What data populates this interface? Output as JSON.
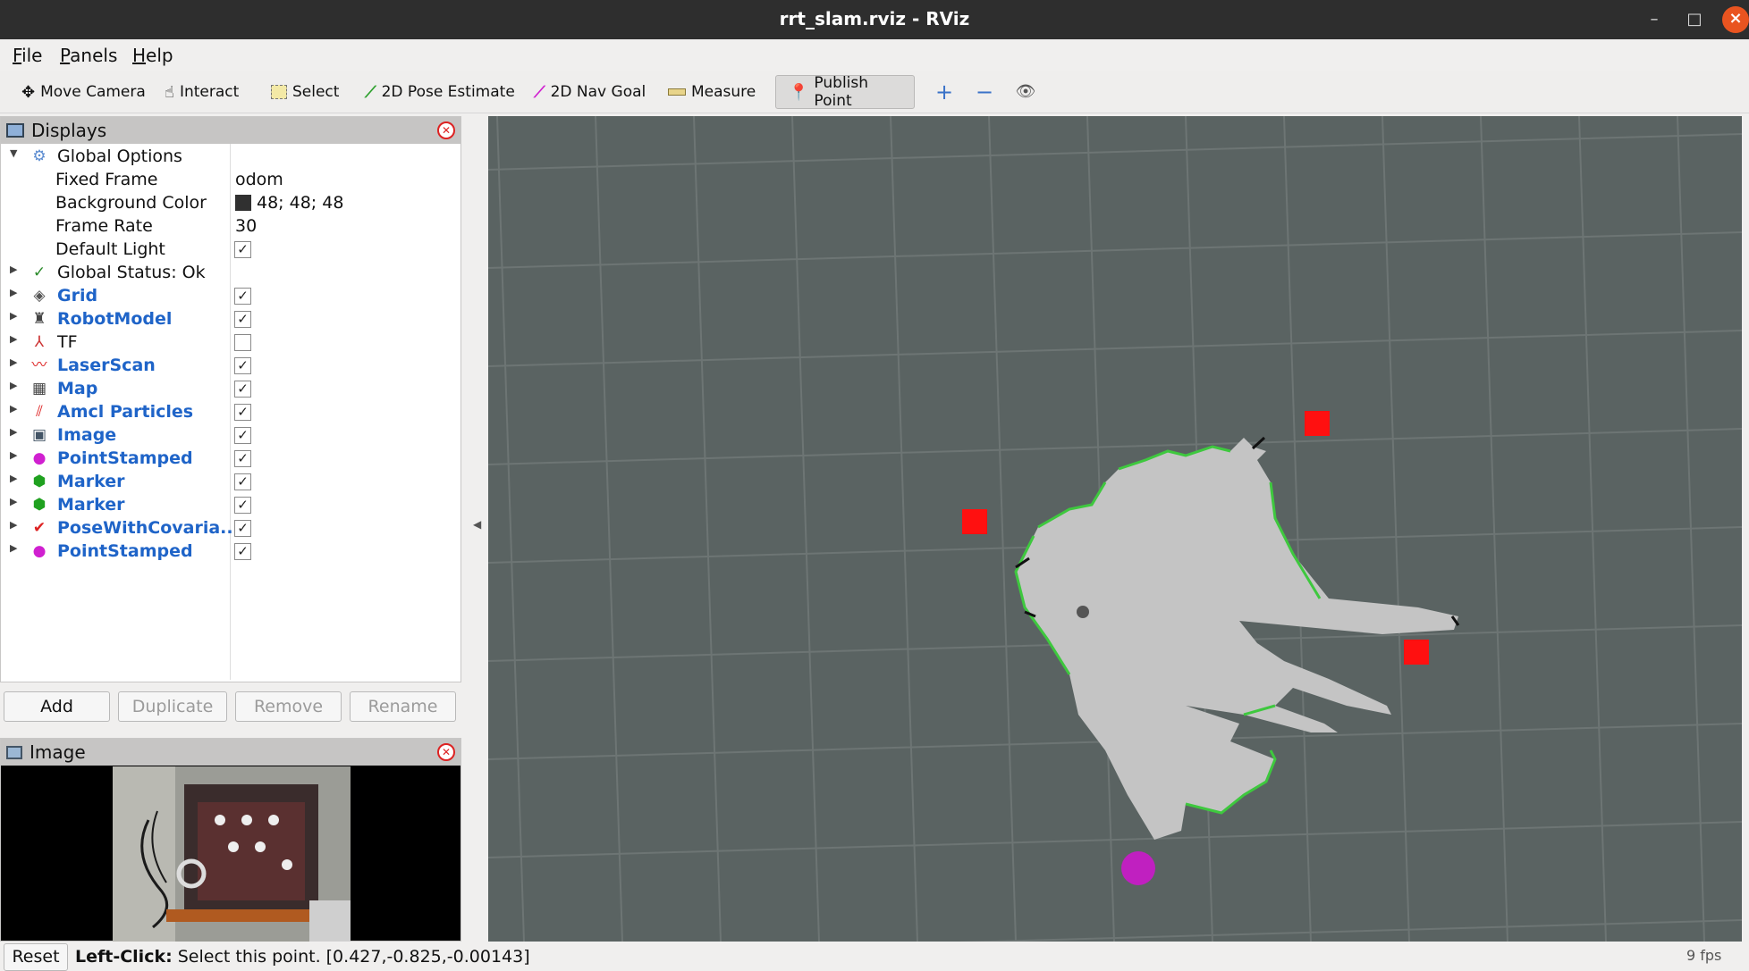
{
  "window": {
    "title": "rrt_slam.rviz - RViz",
    "minimize": "–",
    "maximize": "□",
    "close": "×"
  },
  "menu": [
    "File",
    "Panels",
    "Help"
  ],
  "toolbar": {
    "tools": [
      "Move Camera",
      "Interact",
      "Select",
      "2D Pose Estimate",
      "2D Nav Goal",
      "Measure",
      "Publish Point"
    ],
    "active_tool": "Publish Point",
    "zoom_in": "+",
    "zoom_out": "−",
    "view": "👁"
  },
  "displays": {
    "title": "Displays",
    "global_options": {
      "label": "Global Options",
      "fixed_frame_label": "Fixed Frame",
      "fixed_frame": "odom",
      "bg_color_label": "Background Color",
      "bg_color": "48; 48; 48",
      "bg_color_hex": "#303030",
      "frame_rate_label": "Frame Rate",
      "frame_rate": "30",
      "default_light_label": "Default Light"
    },
    "global_status": "Global Status: Ok",
    "items": [
      {
        "label": "Grid",
        "checked": "✓",
        "icon": "grid-icon"
      },
      {
        "label": "RobotModel",
        "checked": "✓",
        "icon": "robot-icon"
      },
      {
        "label": "TF",
        "checked": "",
        "icon": "tf-icon"
      },
      {
        "label": "LaserScan",
        "checked": "✓",
        "icon": "laserscan-icon"
      },
      {
        "label": "Map",
        "checked": "✓",
        "icon": "map-icon"
      },
      {
        "label": "Amcl Particles",
        "checked": "✓",
        "icon": "particles-icon"
      },
      {
        "label": "Image",
        "checked": "✓",
        "icon": "image-icon"
      },
      {
        "label": "PointStamped",
        "checked": "✓",
        "icon": "point-icon"
      },
      {
        "label": "Marker",
        "checked": "✓",
        "icon": "marker-icon"
      },
      {
        "label": "Marker",
        "checked": "✓",
        "icon": "marker-icon"
      },
      {
        "label": "PoseWithCovaria...",
        "checked": "✓",
        "icon": "pose-icon"
      },
      {
        "label": "PointStamped",
        "checked": "✓",
        "icon": "point-icon"
      }
    ],
    "buttons": {
      "add": "Add",
      "duplicate": "Duplicate",
      "remove": "Remove",
      "rename": "Rename"
    }
  },
  "image_panel": {
    "title": "Image"
  },
  "status_bar": {
    "reset": "Reset",
    "hint_bold": "Left-Click:",
    "hint": "Select this point. [0.427,-0.825,-0.00143]",
    "fps": "9 fps"
  },
  "colors": {
    "view_bg": "#5a6362",
    "grid": "#6d7574",
    "map_free": "#c4c4c4",
    "marker": "#ff1010",
    "point": "#c020c0",
    "link": "#1f64c8"
  }
}
